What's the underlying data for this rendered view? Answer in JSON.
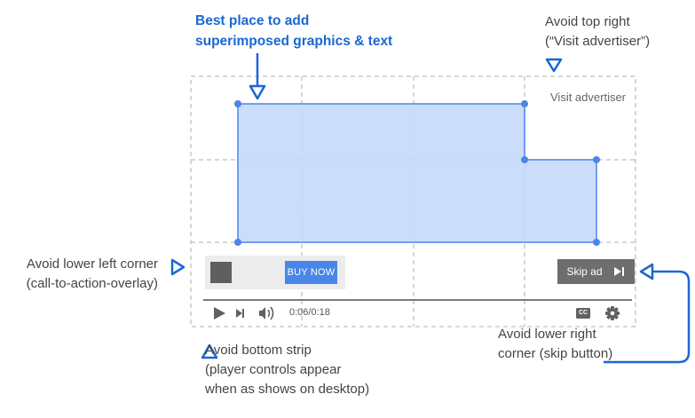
{
  "title_blue": {
    "line1": "Best place to add",
    "line2": "superimposed graphics & text"
  },
  "top_right_note": {
    "line1": "Avoid top right",
    "line2": "(“Visit advertiser”)"
  },
  "left_note": {
    "line1": "Avoid lower left corner",
    "line2": "(call-to-action-overlay)"
  },
  "bottom_note": {
    "line1": "Avoid bottom strip",
    "line2": "(player controls appear",
    "line3": "when as shows on desktop)"
  },
  "right_note": {
    "line1": "Avoid lower right",
    "line2": "corner (skip button)"
  },
  "player": {
    "visit_advertiser": "Visit advertiser",
    "cta_button": "BUY NOW",
    "skip_label": "Skip ad",
    "time": "0:06/0:18",
    "cc": "CC",
    "progress_fraction": 0.0
  },
  "colors": {
    "accent": "#1a67d2",
    "safe_area_fill": "#c3d7fb",
    "safe_area_stroke": "#4a86e8",
    "grid": "#c8c8c8",
    "controls": "#616161"
  },
  "icons": {
    "play": "play-icon",
    "next": "next-icon",
    "volume": "volume-icon",
    "captions": "cc-icon",
    "settings": "gear-icon",
    "skip": "skip-next-icon"
  }
}
